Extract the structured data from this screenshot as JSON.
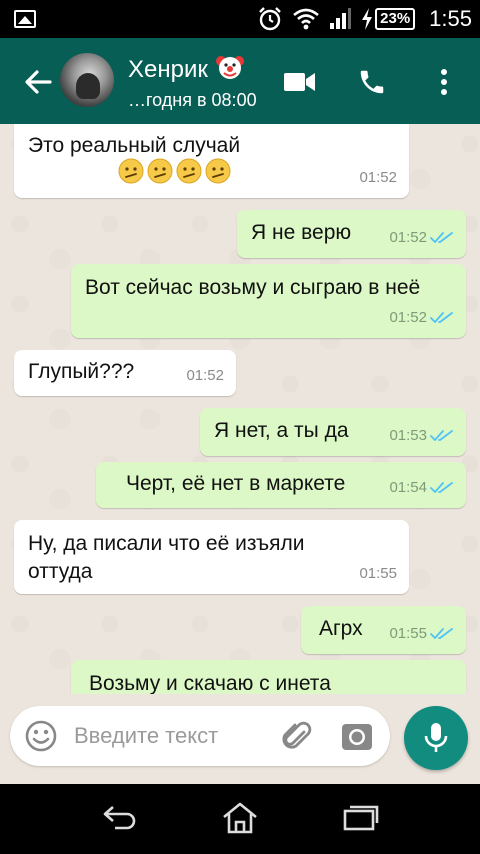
{
  "status_bar": {
    "battery": "23%",
    "time": "1:55"
  },
  "header": {
    "contact_name": "Хенрик",
    "contact_status": "…годня в 08:00"
  },
  "messages": [
    {
      "direction": "in",
      "text": "Это реальный случай",
      "emoji_count": 4,
      "time": "01:52"
    },
    {
      "direction": "out",
      "text": "Я не верю",
      "time": "01:52",
      "status": "read"
    },
    {
      "direction": "out",
      "text": "Вот сейчас возьму и сыграю в неё",
      "time": "01:52",
      "status": "read"
    },
    {
      "direction": "in",
      "text": "Глупый???",
      "time": "01:52"
    },
    {
      "direction": "out",
      "text": "Я нет, а ты да",
      "time": "01:53",
      "status": "read"
    },
    {
      "direction": "out",
      "text": "Черт, её нет в маркете",
      "time": "01:54",
      "status": "read"
    },
    {
      "direction": "in",
      "text": "Ну, да писали что её изъяли оттуда",
      "time": "01:55"
    },
    {
      "direction": "out",
      "text": "Агрх",
      "time": "01:55",
      "status": "read"
    },
    {
      "direction": "out",
      "text": "Возьму и скачаю с инета",
      "time": "",
      "status": "partial"
    }
  ],
  "input": {
    "placeholder": "Введите текст",
    "value": ""
  },
  "colors": {
    "header": "#075E54",
    "accent": "#128C7E",
    "outgoing_bubble": "#dcf8c6",
    "incoming_bubble": "#ffffff",
    "read_ticks": "#4fc3f7",
    "chat_background": "#ece5dd"
  },
  "icons": {
    "status_left": "image-icon",
    "alarm": "alarm-icon",
    "wifi": "wifi-icon",
    "signal": "signal-icon",
    "charging": "charging-bolt-icon",
    "back": "arrow-left-icon",
    "video": "video-camera-icon",
    "call": "phone-icon",
    "menu": "more-vertical-icon",
    "emoji": "smiley-icon",
    "attach": "paperclip-icon",
    "camera": "camera-icon",
    "mic": "microphone-icon",
    "nav_back": "nav-back-icon",
    "nav_home": "nav-home-icon",
    "nav_recent": "nav-recent-icon"
  }
}
